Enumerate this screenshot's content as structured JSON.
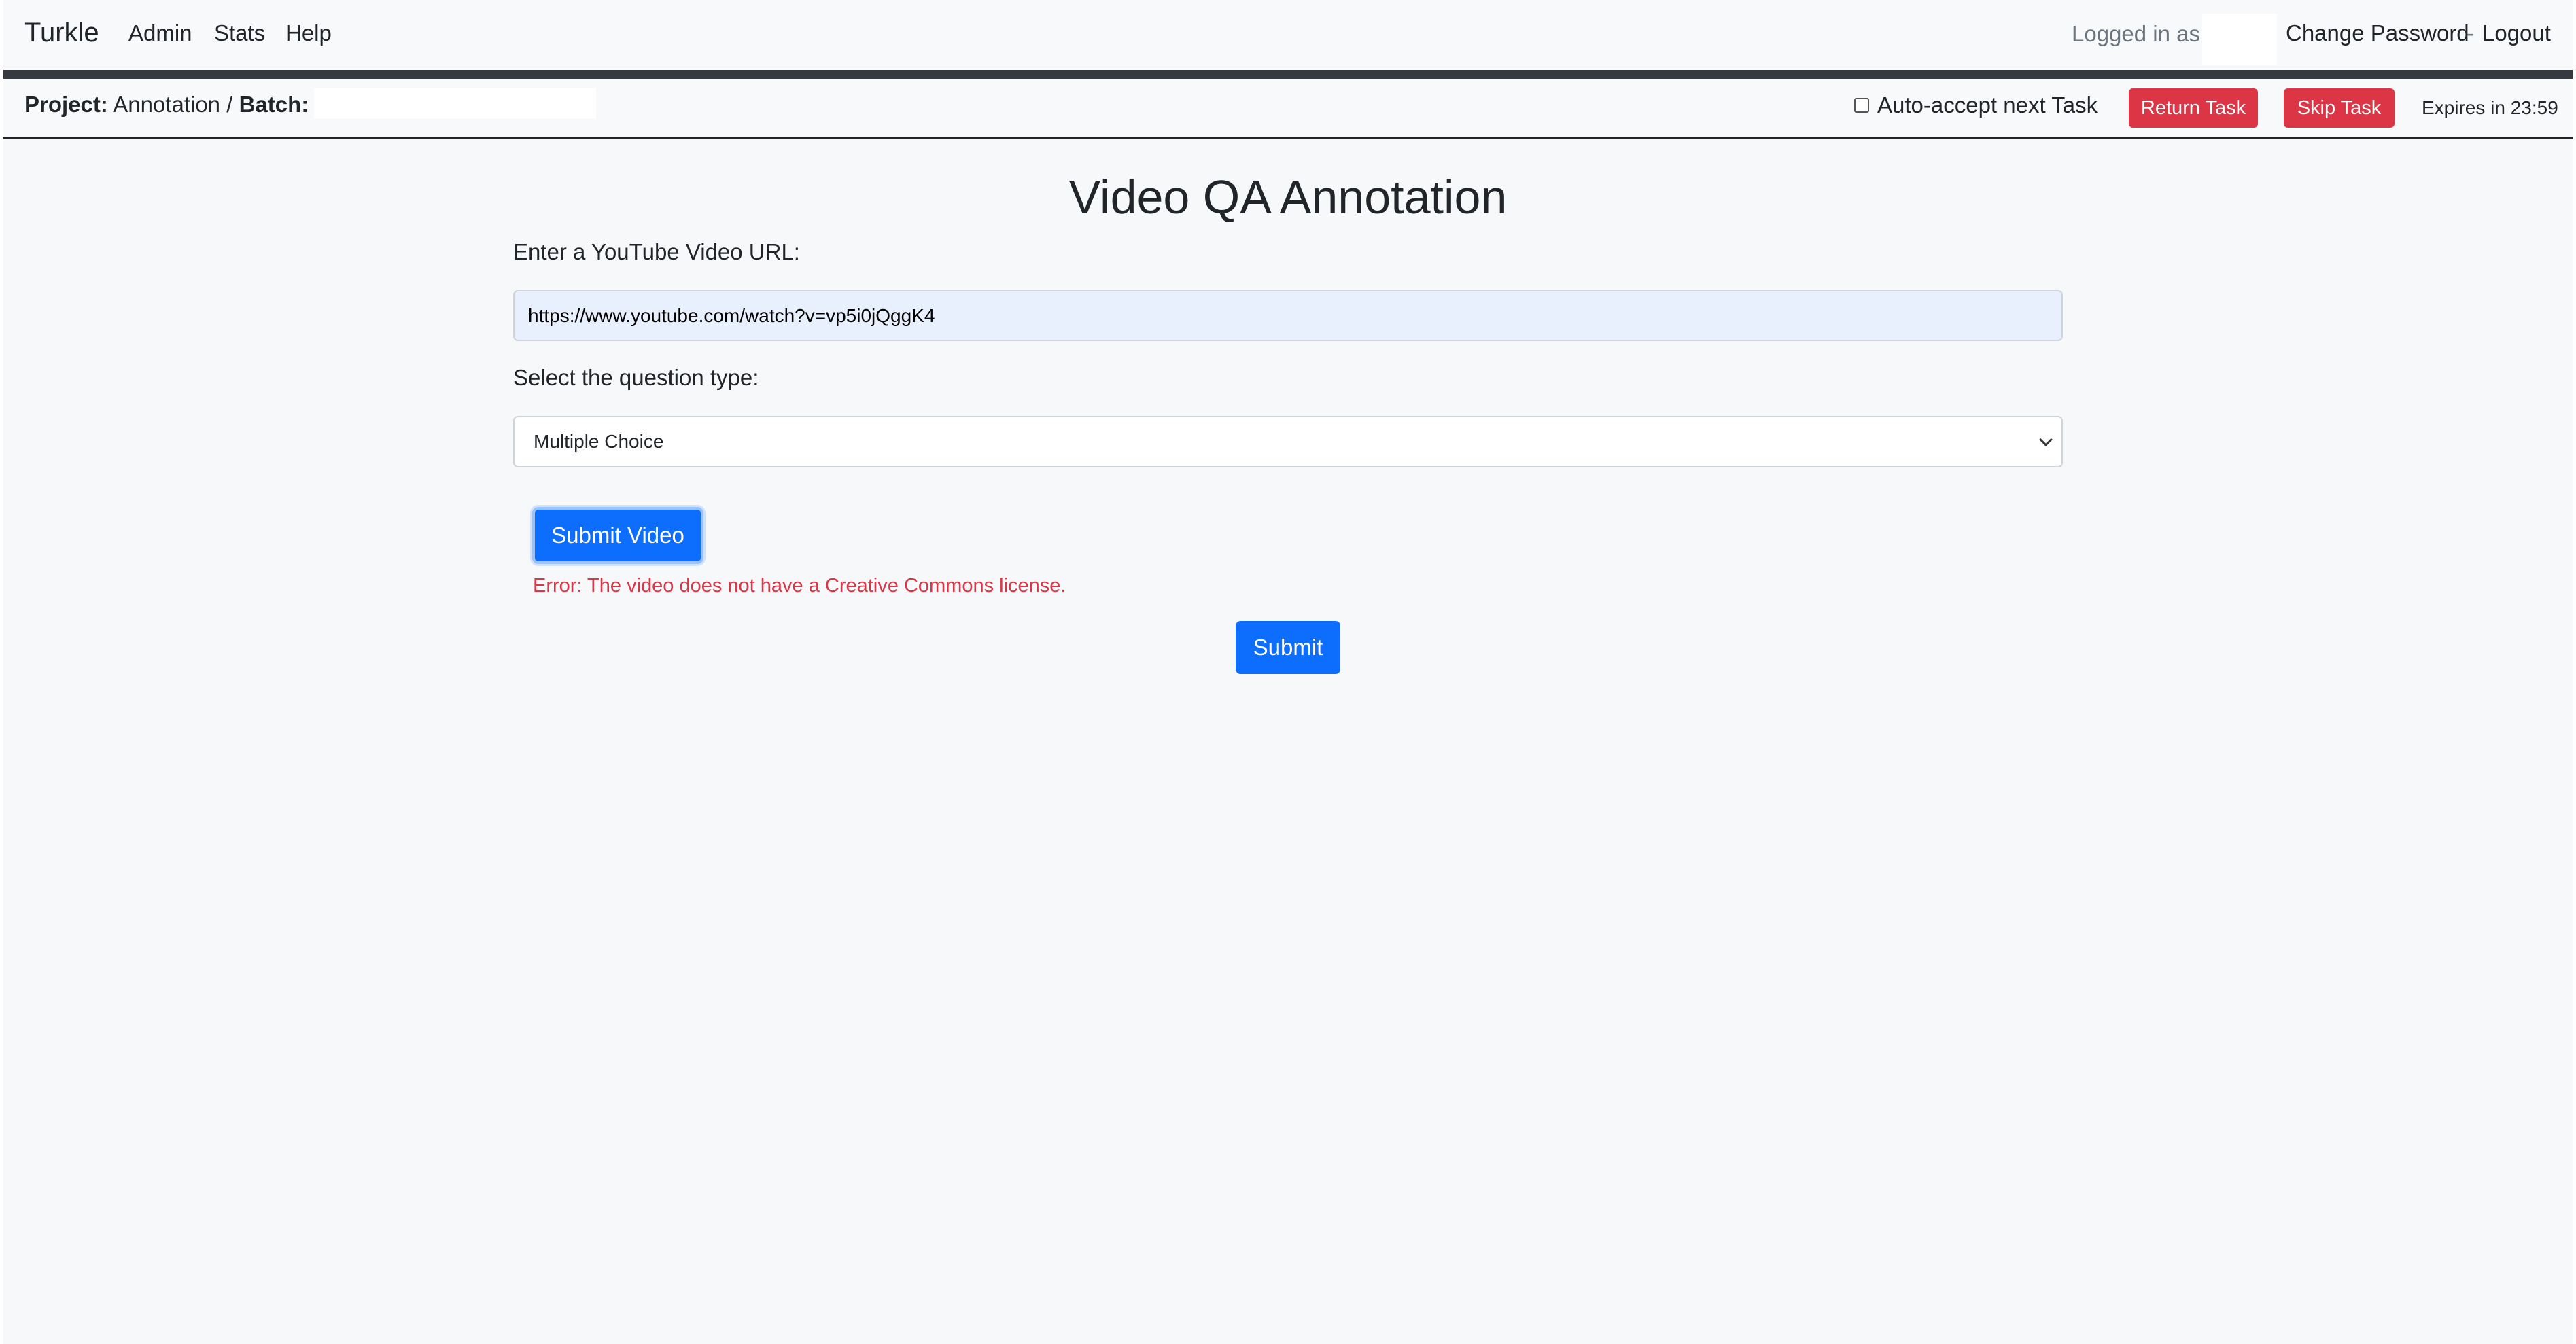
{
  "navbar": {
    "brand": "Turkle",
    "links": [
      "Admin",
      "Stats",
      "Help"
    ],
    "logged_in_label": "Logged in as",
    "change_password": "Change Password",
    "separator": "-",
    "logout": "Logout"
  },
  "project_bar": {
    "project_label": "Project:",
    "project_name": "Annotation",
    "slash": "/",
    "batch_label": "Batch:",
    "auto_accept_label": "Auto-accept next Task",
    "return_task": "Return Task",
    "skip_task": "Skip Task",
    "expires": "Expires in 23:59"
  },
  "form": {
    "title": "Video QA Annotation",
    "url_label": "Enter a YouTube Video URL:",
    "url_value": "https://www.youtube.com/watch?v=vp5i0jQggK4",
    "question_type_label": "Select the question type:",
    "question_type_selected": "Multiple Choice",
    "submit_video": "Submit Video",
    "error": "Error: The video does not have a Creative Commons license.",
    "submit": "Submit"
  },
  "colors": {
    "primary": "#0d6efd",
    "danger": "#dc3545",
    "dark_bar": "#343a40"
  }
}
